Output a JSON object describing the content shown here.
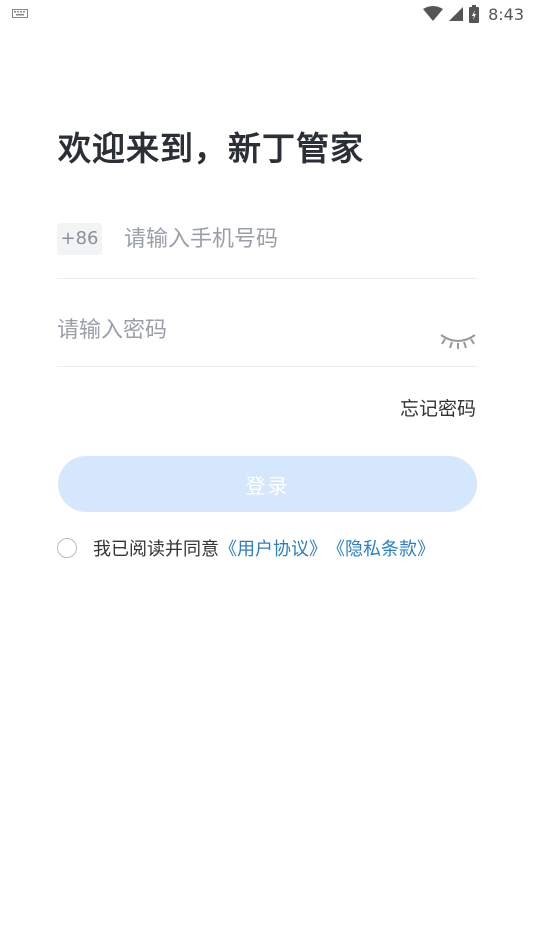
{
  "status_bar": {
    "time": "8:43"
  },
  "login": {
    "title": "欢迎来到，新丁管家",
    "country_code": "+86",
    "phone_placeholder": "请输入手机号码",
    "password_placeholder": "请输入密码",
    "forgot_password": "忘记密码",
    "login_button": "登录",
    "agreement_prefix": "我已阅读并同意",
    "user_agreement": "《用户协议》",
    "privacy_policy": "《隐私条款》"
  },
  "colors": {
    "accent_link": "#2b7ec7",
    "button_disabled": "#d4e7fc",
    "title_text": "#2b2f36"
  }
}
